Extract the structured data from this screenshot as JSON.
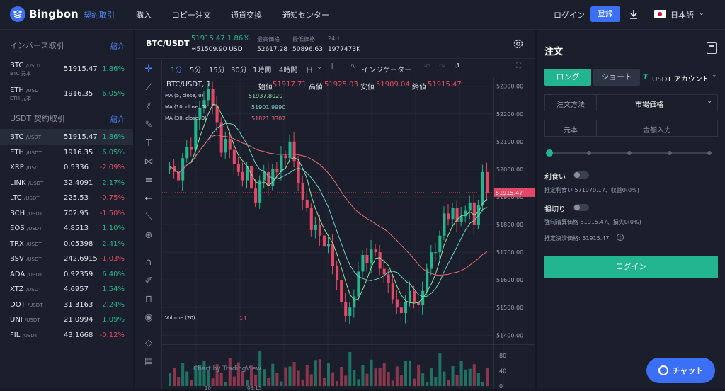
{
  "app": {
    "name": "Bingbon"
  },
  "nav": {
    "items": [
      {
        "label": "契約取引",
        "active": true
      },
      {
        "label": "購入"
      },
      {
        "label": "コピー注文"
      },
      {
        "label": "通貨交換"
      },
      {
        "label": "通知センター"
      }
    ],
    "login": "ログイン",
    "register": "登録",
    "language": "日本語",
    "download_icon": "download-icon"
  },
  "sidebar": {
    "inverse_title": "インバース取引",
    "inverse_link": "紹介",
    "inverse_rows": [
      {
        "sym": "BTC",
        "quote": "/USDT",
        "sub": "BTC 元本",
        "price": "51915.47",
        "change": "1.86%",
        "dir": "up"
      },
      {
        "sym": "ETH",
        "quote": "/USDT",
        "sub": "ETH 元本",
        "price": "1916.35",
        "change": "6.05%",
        "dir": "up"
      }
    ],
    "usdt_title": "USDT 契約取引",
    "usdt_link": "紹介",
    "usdt_rows": [
      {
        "sym": "BTC",
        "quote": "/USDT",
        "price": "51915.47",
        "change": "1.86%",
        "dir": "up",
        "selected": true
      },
      {
        "sym": "ETH",
        "quote": "/USDT",
        "price": "1916.35",
        "change": "6.05%",
        "dir": "up"
      },
      {
        "sym": "XRP",
        "quote": "/USDT",
        "price": "0.5336",
        "change": "-2.09%",
        "dir": "dn"
      },
      {
        "sym": "LINK",
        "quote": "/USDT",
        "price": "32.4091",
        "change": "2.17%",
        "dir": "up"
      },
      {
        "sym": "LTC",
        "quote": "/USDT",
        "price": "225.53",
        "change": "-0.75%",
        "dir": "dn"
      },
      {
        "sym": "BCH",
        "quote": "/USDT",
        "price": "702.95",
        "change": "-1.50%",
        "dir": "dn"
      },
      {
        "sym": "EOS",
        "quote": "/USDT",
        "price": "4.8513",
        "change": "1.10%",
        "dir": "up"
      },
      {
        "sym": "TRX",
        "quote": "/USDT",
        "price": "0.05398",
        "change": "2.41%",
        "dir": "up"
      },
      {
        "sym": "BSV",
        "quote": "/USDT",
        "price": "242.6915",
        "change": "-1.03%",
        "dir": "dn"
      },
      {
        "sym": "ADA",
        "quote": "/USDT",
        "price": "0.92359",
        "change": "6.40%",
        "dir": "up"
      },
      {
        "sym": "XTZ",
        "quote": "/USDT",
        "price": "4.6957",
        "change": "1.54%",
        "dir": "up"
      },
      {
        "sym": "DOT",
        "quote": "/USDT",
        "price": "31.3163",
        "change": "2.24%",
        "dir": "up"
      },
      {
        "sym": "UNI",
        "quote": "/USDT",
        "price": "21.0994",
        "change": "1.09%",
        "dir": "up"
      },
      {
        "sym": "FIL",
        "quote": "/USDT",
        "price": "43.1668",
        "change": "-0.12%",
        "dir": "dn"
      }
    ]
  },
  "ticker": {
    "pair": "BTC/USDT",
    "last": "51915.47",
    "change": "1.86%",
    "usd": "≈51509.90 USD",
    "high_label": "最高価格",
    "high": "52617.28",
    "low_label": "最低価格",
    "low": "50896.63",
    "vol_label": "24H",
    "vol": "1977473K"
  },
  "chart_toolbar": {
    "intervals": [
      "1分",
      "5分",
      "15分",
      "30分",
      "1時間",
      "4時間",
      "日"
    ],
    "active_interval": "1分",
    "indicator": "インジケーター"
  },
  "chart_legend": {
    "title": "BTC/USDT, 1",
    "open_label": "始値",
    "open": "51917.71",
    "high_label": "高値",
    "high": "51925.03",
    "low_label": "安値",
    "low": "51909.04",
    "close_label": "終値",
    "close": "51915.47",
    "ma": [
      {
        "label": "MA (5, close, 0)",
        "value": "51937.8020",
        "color": "#8fe3a0"
      },
      {
        "label": "MA (10, close, 0)",
        "value": "51901.9990",
        "color": "#6fd0c8"
      },
      {
        "label": "MA (30, close, 0)",
        "value": "51821.3307",
        "color": "#e86a7e"
      }
    ],
    "volume_label": "Volume (20)",
    "volume_value": "14",
    "watermark": "Chart by TradingView",
    "x_ticks": [
      "10",
      "09:15"
    ]
  },
  "chart_data": {
    "type": "candlestick",
    "y_ticks": [
      52300,
      52200,
      52100,
      52000,
      51900,
      51800,
      51700,
      51600,
      51500,
      51400
    ],
    "y_range": [
      51370,
      52330
    ],
    "last_price": 51915.47,
    "last_price_label": "51915.47",
    "volume_ticks": [
      80,
      40,
      0
    ],
    "volume_range": [
      0,
      100
    ]
  },
  "order": {
    "title": "注文",
    "long": "ロング",
    "short": "ショート",
    "account": "USDT アカウント",
    "method_label": "注文方法",
    "method_value": "市場価格",
    "principal": "元本",
    "amount_placeholder": "金額入力",
    "take_profit": "利食い",
    "take_profit_detail": "推定利食い 571070.17、収益0(0%)",
    "stop_loss": "損切り",
    "stop_loss_detail": "強制清算価格 51915.47、損失0(0%)",
    "settle": "推定決済価格: 51915.47",
    "login_button": "ログイン"
  },
  "chat": {
    "label": "チャット"
  }
}
